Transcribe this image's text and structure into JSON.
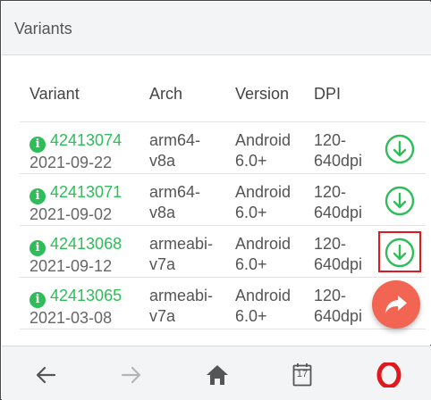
{
  "header": {
    "title": "Variants"
  },
  "table": {
    "columns": [
      "Variant",
      "Arch",
      "Version",
      "DPI"
    ],
    "rows": [
      {
        "id": "42413074",
        "date": "2021-09-22",
        "arch_line1": "arm64-",
        "arch_line2": "v8a",
        "version_line1": "Android",
        "version_line2": "6.0+",
        "dpi_line1": "120-",
        "dpi_line2": "640dpi"
      },
      {
        "id": "42413071",
        "date": "2021-09-02",
        "arch_line1": "arm64-",
        "arch_line2": "v8a",
        "version_line1": "Android",
        "version_line2": "6.0+",
        "dpi_line1": "120-",
        "dpi_line2": "640dpi"
      },
      {
        "id": "42413068",
        "date": "2021-09-12",
        "arch_line1": "armeabi-",
        "arch_line2": "v7a",
        "version_line1": "Android",
        "version_line2": "6.0+",
        "dpi_line1": "120-",
        "dpi_line2": "640dpi"
      },
      {
        "id": "42413065",
        "date": "2021-03-08",
        "arch_line1": "armeabi-",
        "arch_line2": "v7a",
        "version_line1": "Android",
        "version_line2": "6.0+",
        "dpi_line1": "120-",
        "dpi_line2": "640dpi"
      }
    ]
  },
  "icons": {
    "info": "info-icon",
    "download": "download-circle-icon",
    "share": "share-icon",
    "back": "back-arrow-icon",
    "forward": "forward-arrow-icon",
    "home": "home-icon",
    "calendar": "calendar-icon",
    "opera": "opera-logo-icon"
  },
  "calendar_day": "17",
  "colors": {
    "accent_green": "#2ebd59",
    "fab_red": "#f26552",
    "opera_red": "#e0191f",
    "highlight_red": "#e0191f"
  }
}
